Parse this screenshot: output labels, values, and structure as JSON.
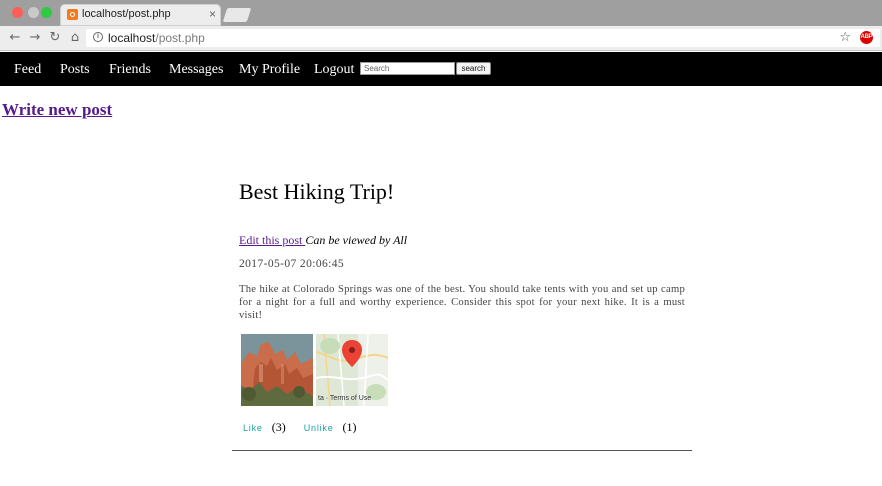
{
  "browser": {
    "tab_title": "localhost/post.php",
    "close_glyph": "×",
    "url_host": "localhost",
    "url_path": "/post.php",
    "back_icon": "←",
    "forward_icon": "→",
    "reload_icon": "↻",
    "home_icon": "⌂",
    "info_icon": "i",
    "star_icon": "☆",
    "extension_label": "ABP"
  },
  "nav": {
    "items": [
      {
        "label": "Feed"
      },
      {
        "label": "Posts"
      },
      {
        "label": "Friends"
      },
      {
        "label": "Messages"
      },
      {
        "label": "My Profile"
      },
      {
        "label": "Logout"
      }
    ],
    "search_placeholder": "Search",
    "search_button": "search"
  },
  "main": {
    "write_link": "Write new post",
    "post": {
      "title": "Best Hiking Trip!",
      "edit_link": "Edit this post ",
      "visibility": "Can be viewed by All",
      "date": "2017-05-07 20:06:45",
      "body": "The hike at Colorado Springs was one of the best. You should take tents with you and set up camp for a night for a full and worthy experience. Consider this spot for your next hike. It is a must visit!",
      "map_caption": "ta · Terms of Use",
      "like_label": "Like",
      "like_count": "(3)",
      "unlike_label": "Unlike",
      "unlike_count": "(1)"
    }
  },
  "colors": {
    "nav_bg": "#000000",
    "link": "#551a8b",
    "reaction": "#1aa3a3"
  }
}
